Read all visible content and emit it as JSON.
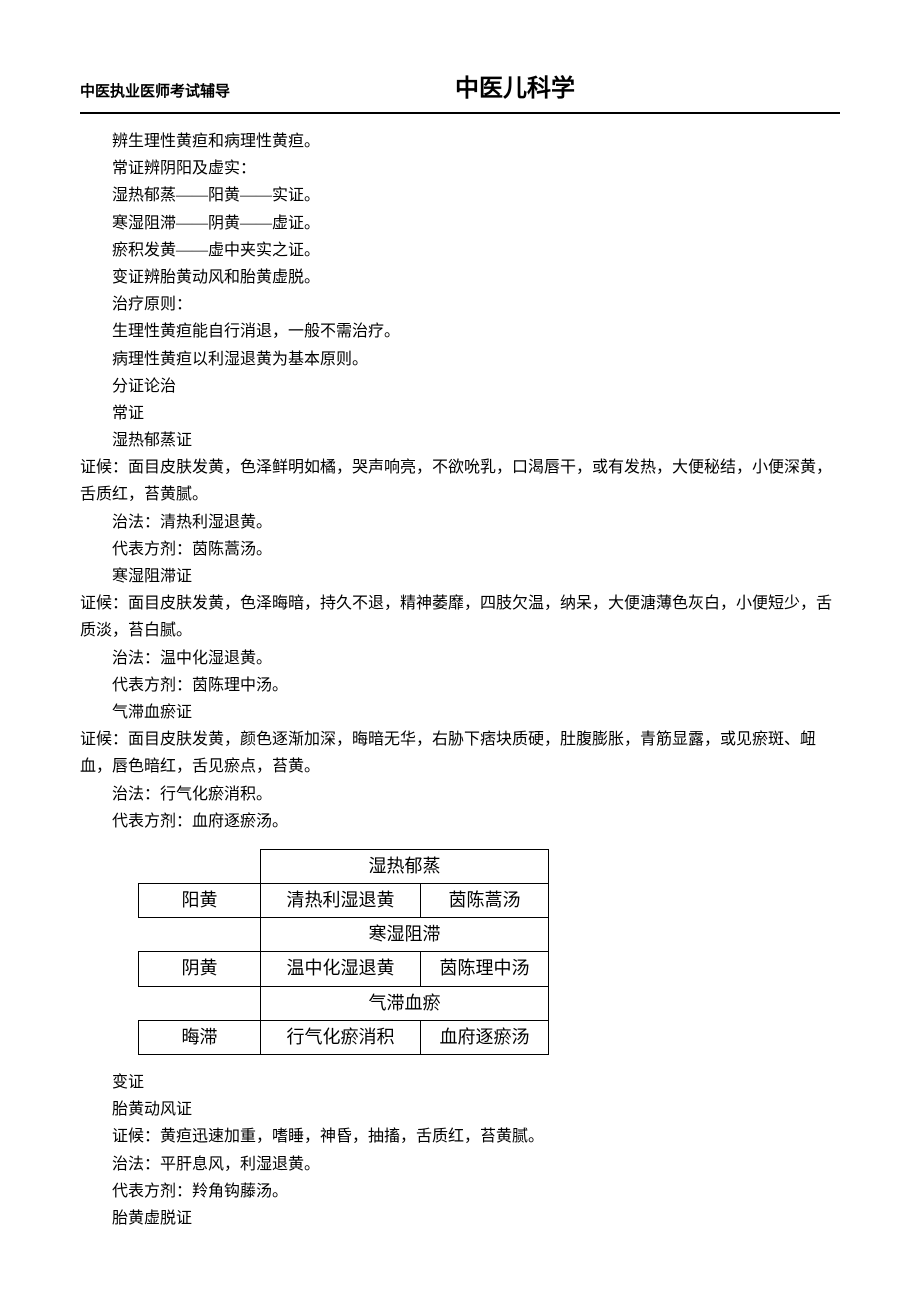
{
  "header": {
    "left": "中医执业医师考试辅导",
    "title": "中医儿科学"
  },
  "paragraphs": [
    "辨生理性黄疸和病理性黄疸。",
    "常证辨阴阳及虚实：",
    "湿热郁蒸——阳黄——实证。",
    "寒湿阻滞——阴黄——虚证。",
    "瘀积发黄——虚中夹实之证。",
    "变证辨胎黄动风和胎黄虚脱。",
    "治疗原则：",
    "生理性黄疸能自行消退，一般不需治疗。",
    "病理性黄疸以利湿退黄为基本原则。",
    "分证论治",
    "常证",
    "湿热郁蒸证",
    "证候：面目皮肤发黄，色泽鲜明如橘，哭声响亮，不欲吮乳，口渴唇干，或有发热，大便秘结，小便深黄，舌质红，苔黄腻。",
    "治法：清热利湿退黄。",
    "代表方剂：茵陈蒿汤。",
    "寒湿阻滞证",
    "证候：面目皮肤发黄，色泽晦暗，持久不退，精神萎靡，四肢欠温，纳呆，大便溏薄色灰白，小便短少，舌质淡，苔白腻。",
    "治法：温中化湿退黄。",
    "代表方剂：茵陈理中汤。",
    "气滞血瘀证",
    "证候：面目皮肤发黄，颜色逐渐加深，晦暗无华，右胁下痞块质硬，肚腹膨胀，青筋显露，或见瘀斑、衄血，唇色暗红，舌见瘀点，苔黄。",
    "治法：行气化瘀消积。",
    "代表方剂：血府逐瘀汤。"
  ],
  "paragraphs_noindent_idx": [
    12,
    16,
    20
  ],
  "chart_data": {
    "type": "table",
    "rows": [
      {
        "pattern": "湿热郁蒸"
      },
      {
        "category": "阳黄",
        "method": "清热利湿退黄",
        "formula": "茵陈蒿汤"
      },
      {
        "pattern": "寒湿阻滞"
      },
      {
        "category": "阴黄",
        "method": "温中化湿退黄",
        "formula": "茵陈理中汤"
      },
      {
        "pattern": "气滞血瘀"
      },
      {
        "category": "晦滞",
        "method": "行气化瘀消积",
        "formula": "血府逐瘀汤"
      }
    ]
  },
  "paragraphs2": [
    "变证",
    "胎黄动风证",
    "证候：黄疸迅速加重，嗜睡，神昏，抽搐，舌质红，苔黄腻。",
    "治法：平肝息风，利湿退黄。",
    "代表方剂：羚角钩藤汤。",
    "胎黄虚脱证"
  ]
}
